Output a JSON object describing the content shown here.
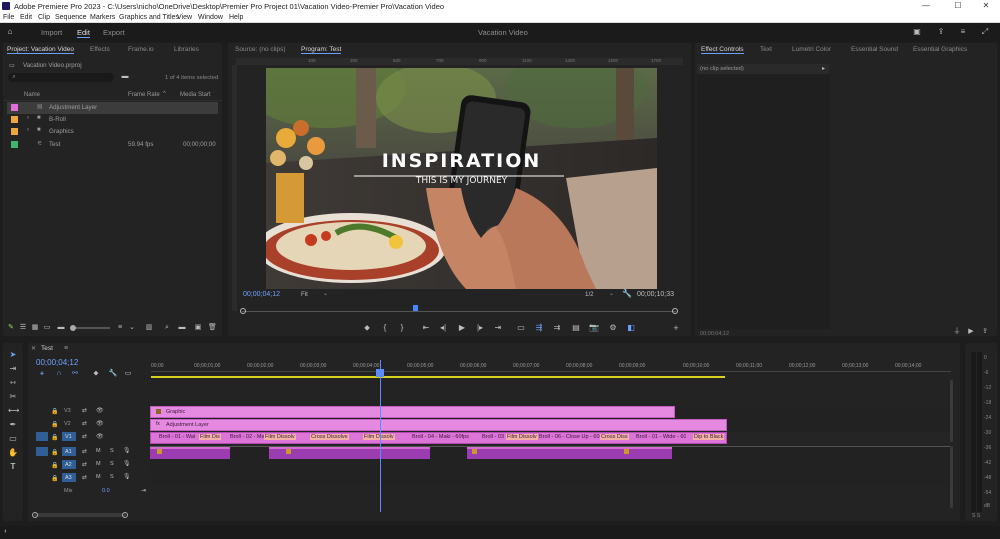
{
  "window": {
    "title": "Adobe Premiere Pro 2023 - C:\\Users\\nicho\\OneDrive\\Desktop\\Premier Pro Project 01\\Vacation Video-Premier Pro\\Vacation Video",
    "minimize": "—",
    "maximize": "☐",
    "close": "✕"
  },
  "menu": [
    "File",
    "Edit",
    "Clip",
    "Sequence",
    "Markers",
    "Graphics and Titles",
    "View",
    "Window",
    "Help"
  ],
  "header": {
    "tabs": [
      "Import",
      "Edit",
      "Export"
    ],
    "active_tab": "Edit",
    "project_name": "Vacation Video"
  },
  "project_panel": {
    "tabs": [
      "Project: Vacation Video",
      "Effects",
      "Frame.io",
      "Libraries"
    ],
    "file": "Vacation Video.prproj",
    "selection_info": "1 of 4 items selected",
    "columns": [
      "Name",
      "Frame Rate",
      "Media Start"
    ],
    "items": [
      {
        "name": "Adjustment Layer",
        "frame_rate": "",
        "media_start": "",
        "color": "#e26fd9",
        "selected": true
      },
      {
        "name": "B-Roll",
        "frame_rate": "",
        "media_start": "",
        "color": "#f0a640",
        "selected": false
      },
      {
        "name": "Graphics",
        "frame_rate": "",
        "media_start": "",
        "color": "#f0a640",
        "selected": false
      },
      {
        "name": "Test",
        "frame_rate": "59.94 fps",
        "media_start": "00;00;00;00",
        "color": "#3fb56a",
        "selected": false
      }
    ]
  },
  "program_monitor": {
    "tabs": [
      "Source: (no clips)",
      "Program: Test"
    ],
    "ruler": [
      "100",
      "200",
      "300",
      "400",
      "500",
      "600",
      "700",
      "800",
      "900",
      "1000",
      "1100",
      "1200",
      "1300",
      "1400",
      "1500",
      "1600",
      "1700",
      "1800"
    ],
    "overlay_title": "INSPIRATION",
    "overlay_subtitle": "THIS IS MY JOURNEY",
    "timecode": "00;00;04;12",
    "fit": "Fit",
    "resolution": "1/2",
    "duration": "00;00;10;33"
  },
  "effect_controls": {
    "tabs": [
      "Effect Controls",
      "Text",
      "Lumetri Color",
      "Essential Sound",
      "Essential Graphics"
    ],
    "no_clip": "(no clip selected)",
    "timecode": "00;00;04;12"
  },
  "timeline": {
    "sequence_name": "Test",
    "timecode": "00;00;04;12",
    "ruler": [
      "00;00",
      "00;00;01;00",
      "00;00;02;00",
      "00;00;03;00",
      "00;00;04;00",
      "00;00;05;00",
      "00;00;06;00",
      "00;00;07;00",
      "00;00;08;00",
      "00;00;09;00",
      "00;00;10;00",
      "00;00;11;00",
      "00;00;12;00",
      "00;00;13;00",
      "00;00;14;00"
    ],
    "tracks": {
      "video": [
        "V3",
        "V2",
        "V1"
      ],
      "audio": [
        "A1",
        "A2",
        "A3"
      ],
      "mix": "Mix",
      "mix_value": "0.0"
    },
    "clips": {
      "graphic": "Graphic",
      "adjustment": "Adjustment Layer",
      "v1": [
        "Broll - 01 - Wat",
        "Film Dis",
        "Broll - 02 - Me",
        "Film Dissolv",
        "Cross Dissolve",
        "Film Dissolv",
        "Broll - 04 - Maki - 60fps",
        "Broll - 03",
        "Film Dissolv",
        "Broll - 06 - Close Up - 60",
        "Cross Diss",
        "Broll - 01 - Wide - 60",
        "Dip to Black"
      ]
    },
    "meter": [
      "0",
      "-6",
      "-12",
      "-18",
      "-24",
      "-30",
      "-36",
      "-42",
      "-48",
      "-54",
      "dB"
    ],
    "meter_bottom": "S S"
  },
  "colors": {
    "accent": "#3a8df0",
    "clip_pink": "#e57fde",
    "clip_pink_dark": "#c65ac4",
    "audio_bar": "#9b3db0"
  }
}
